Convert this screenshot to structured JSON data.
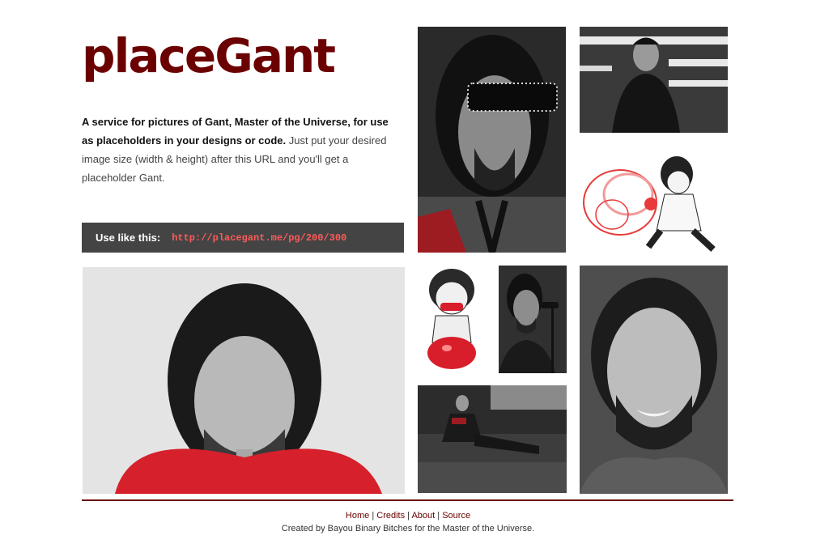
{
  "header": {
    "logo": "placeGant"
  },
  "intro": {
    "bold": "A service for pictures of Gant, Master of the Universe, for use as placeholders in your designs or code.",
    "rest": "Just put your desired image size (width & height) after this URL and you'll get a placeholder Gant."
  },
  "usage": {
    "label": "Use like this:",
    "url": "http://placegant.me/pg/200/300"
  },
  "footer": {
    "links": [
      "Home",
      "Credits",
      "About",
      "Source"
    ],
    "separator": "|",
    "credit": "Created by Bayou Binary Bitches for the Master of the Universe."
  },
  "colors": {
    "brand": "#6b0000",
    "url": "#ff5a5a",
    "bar": "#444444"
  }
}
